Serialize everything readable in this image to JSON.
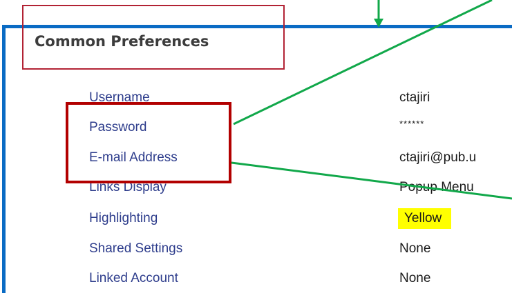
{
  "section": {
    "title": "Common Preferences"
  },
  "preferences": [
    {
      "label": "Username",
      "value": "ctajiri"
    },
    {
      "label": "Password",
      "value": "******"
    },
    {
      "label": "E-mail Address",
      "value": "ctajiri@pub.u"
    },
    {
      "label": "Links Display",
      "value": "Popup Menu"
    },
    {
      "label": "Highlighting",
      "value": "Yellow"
    },
    {
      "label": "Shared Settings",
      "value": "None"
    },
    {
      "label": "Linked Account",
      "value": "None"
    }
  ],
  "colors": {
    "panel_border": "#0a6bc4",
    "label_text": "#2e3d8c",
    "highlight_swatch": "#ffff00",
    "annotation_box": "#b20000",
    "annotation_arrow": "#11a84a"
  },
  "icons": {
    "annotation_arrow": "arrow-line-icon"
  }
}
